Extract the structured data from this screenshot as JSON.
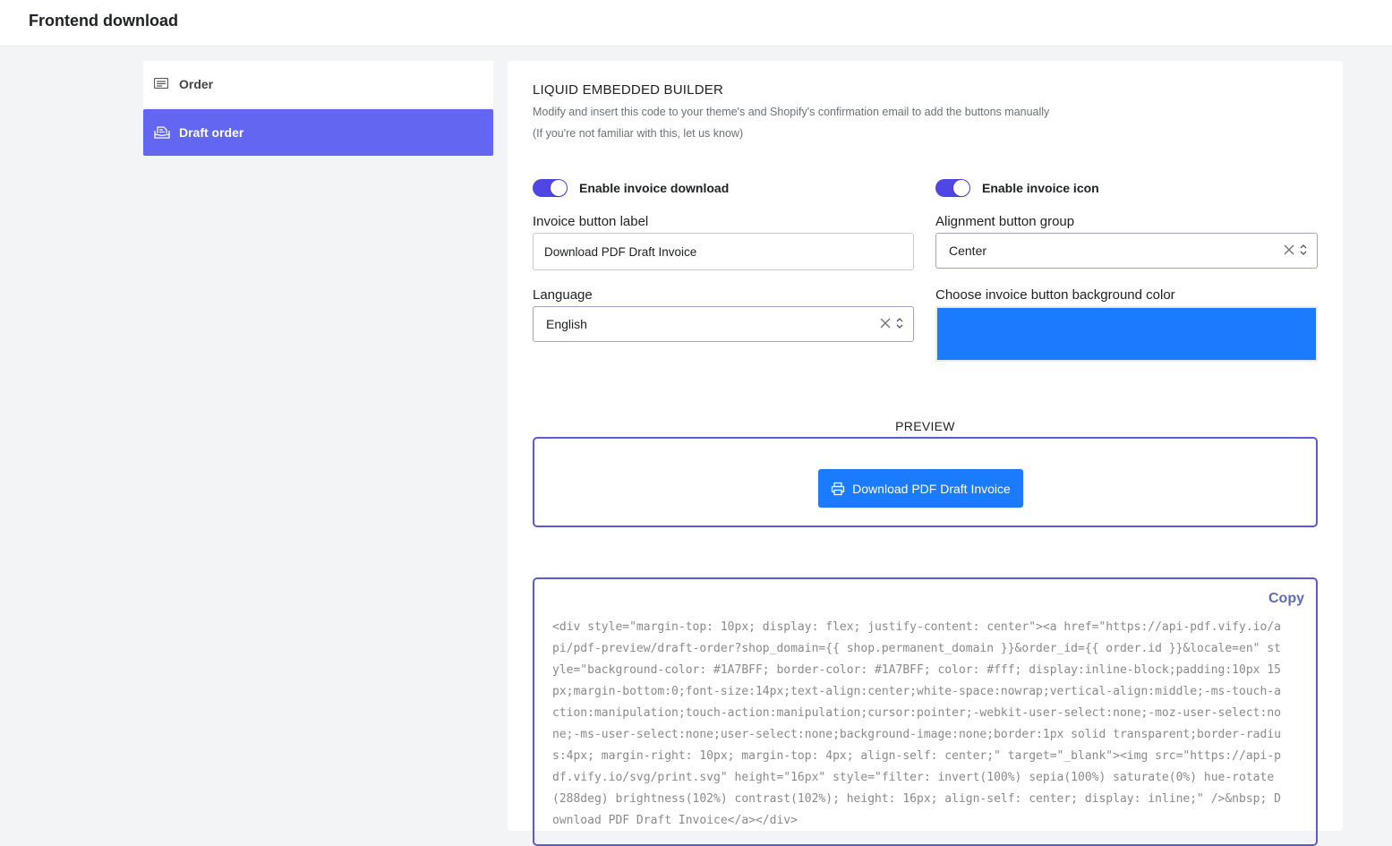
{
  "header": {
    "title": "Frontend download"
  },
  "sidebar": {
    "items": [
      {
        "label": "Order",
        "icon": "receipt-icon",
        "active": false
      },
      {
        "label": "Draft order",
        "icon": "draft-order-icon",
        "active": true
      }
    ]
  },
  "main": {
    "title": "LIQUID EMBEDDED BUILDER",
    "description": "Modify and insert this code to your theme's and Shopify's confirmation email to add the buttons manually",
    "note": "(If you're not familiar with this, let us know)",
    "toggles": {
      "enable_download": {
        "label": "Enable invoice download",
        "on": true
      },
      "enable_icon": {
        "label": "Enable invoice icon",
        "on": true
      }
    },
    "invoice_label": {
      "label": "Invoice button label",
      "value": "Download PDF Draft Invoice"
    },
    "alignment": {
      "label": "Alignment button group",
      "value": "Center"
    },
    "language": {
      "label": "Language",
      "value": "English"
    },
    "bg_color": {
      "label": "Choose invoice button background color",
      "value": "#1A7BFF"
    },
    "preview": {
      "label": "PREVIEW",
      "button_label": "Download PDF Draft Invoice"
    },
    "code": {
      "copy_label": "Copy",
      "text": "<div style=\"margin-top: 10px; display: flex; justify-content: center\"><a href=\"https://api-pdf.vify.io/api/pdf-preview/draft-order?shop_domain={{ shop.permanent_domain }}&order_id={{ order.id }}&locale=en\" style=\"background-color: #1A7BFF; border-color: #1A7BFF; color: #fff; display:inline-block;padding:10px 15px;margin-bottom:0;font-size:14px;text-align:center;white-space:nowrap;vertical-align:middle;-ms-touch-action:manipulation;touch-action:manipulation;cursor:pointer;-webkit-user-select:none;-moz-user-select:none;-ms-user-select:none;user-select:none;background-image:none;border:1px solid transparent;border-radius:4px; margin-right: 10px; margin-top: 4px; align-self: center;\" target=\"_blank\"><img src=\"https://api-pdf.vify.io/svg/print.svg\" height=\"16px\" style=\"filter: invert(100%) sepia(100%) saturate(0%) hue-rotate(288deg) brightness(102%) contrast(102%); height: 16px; align-self: center; display: inline;\" />&nbsp; Download PDF Draft Invoice</a></div>"
    }
  },
  "colors": {
    "accent": "#6366F1",
    "toggle": "#4F46E5",
    "button": "#1A7BFF"
  }
}
